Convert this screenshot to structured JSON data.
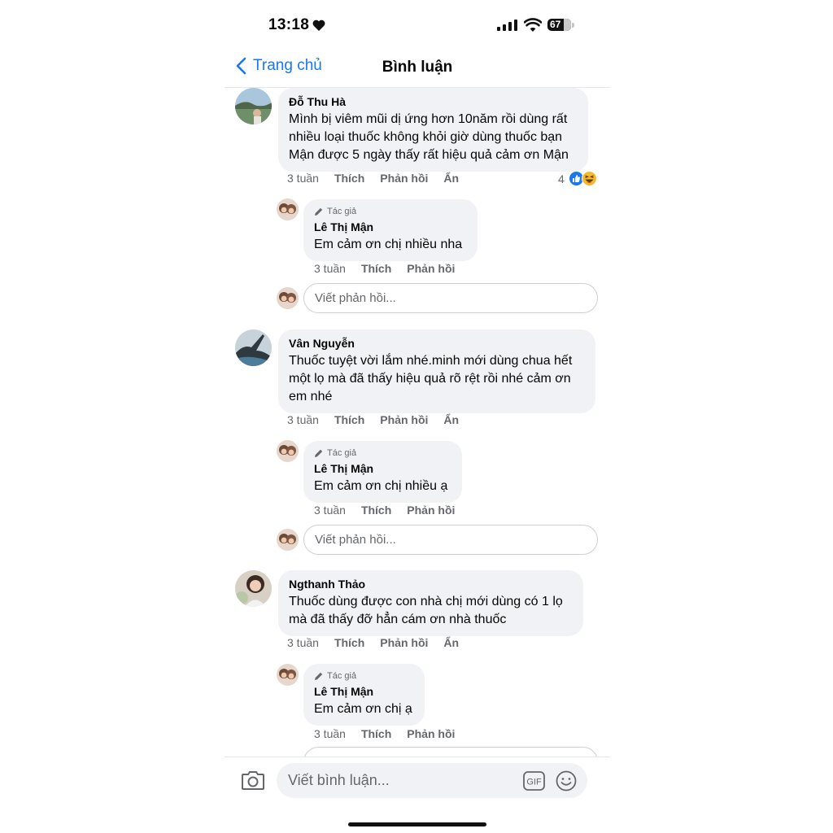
{
  "status": {
    "time": "13:18",
    "battery": "67"
  },
  "nav": {
    "back_label": "Trang chủ",
    "title": "Bình luận"
  },
  "comments": [
    {
      "author": "Đỗ Thu Hà",
      "text": "Mình bị viêm mũi dị ứng hơn 10năm rồi dùng rất nhiều loại thuốc không khỏi giờ dùng thuốc bạn Mận được 5 ngày thấy rất hiệu quả cảm ơn Mận",
      "time": "3 tuần",
      "like": "Thích",
      "reply": "Phản hồi",
      "hide": "Ẩn",
      "reaction_count": "4",
      "author_reply": {
        "badge": "Tác giả",
        "author": "Lê Thị Mận",
        "text": "Em cảm ơn chị nhiều nha",
        "time": "3 tuần",
        "like": "Thích",
        "reply": "Phản hồi"
      },
      "reply_placeholder": "Viết phản hồi..."
    },
    {
      "author": "Vân Nguyễn",
      "text": "Thuốc tuyệt vời lắm nhé.minh mới dùng chua hết một lọ mà đã thấy hiệu quả rõ rệt rồi nhé cảm ơn em nhé",
      "time": "3 tuần",
      "like": "Thích",
      "reply": "Phản hồi",
      "hide": "Ẩn",
      "author_reply": {
        "badge": "Tác giả",
        "author": "Lê Thị Mận",
        "text": "Em cảm ơn chị nhiều ạ",
        "time": "3 tuần",
        "like": "Thích",
        "reply": "Phản hồi"
      },
      "reply_placeholder": "Viết phản hồi..."
    },
    {
      "author": "Ngthanh Thảo",
      "text": "Thuốc dùng được con nhà chị mới dùng có 1 lọ mà đã thấy đỡ hẳn cám ơn nhà thuốc",
      "time": "3 tuần",
      "like": "Thích",
      "reply": "Phản hồi",
      "hide": "Ẩn",
      "author_reply": {
        "badge": "Tác giả",
        "author": "Lê Thị Mận",
        "text": "Em cảm ơn chị ạ",
        "time": "3 tuần",
        "like": "Thích",
        "reply": "Phản hồi"
      }
    }
  ],
  "composer": {
    "placeholder": "Viết bình luận...",
    "gif_label": "GIF"
  },
  "colors": {
    "accent": "#1877f2",
    "bubble": "#f0f2f5",
    "muted": "#65676b"
  }
}
